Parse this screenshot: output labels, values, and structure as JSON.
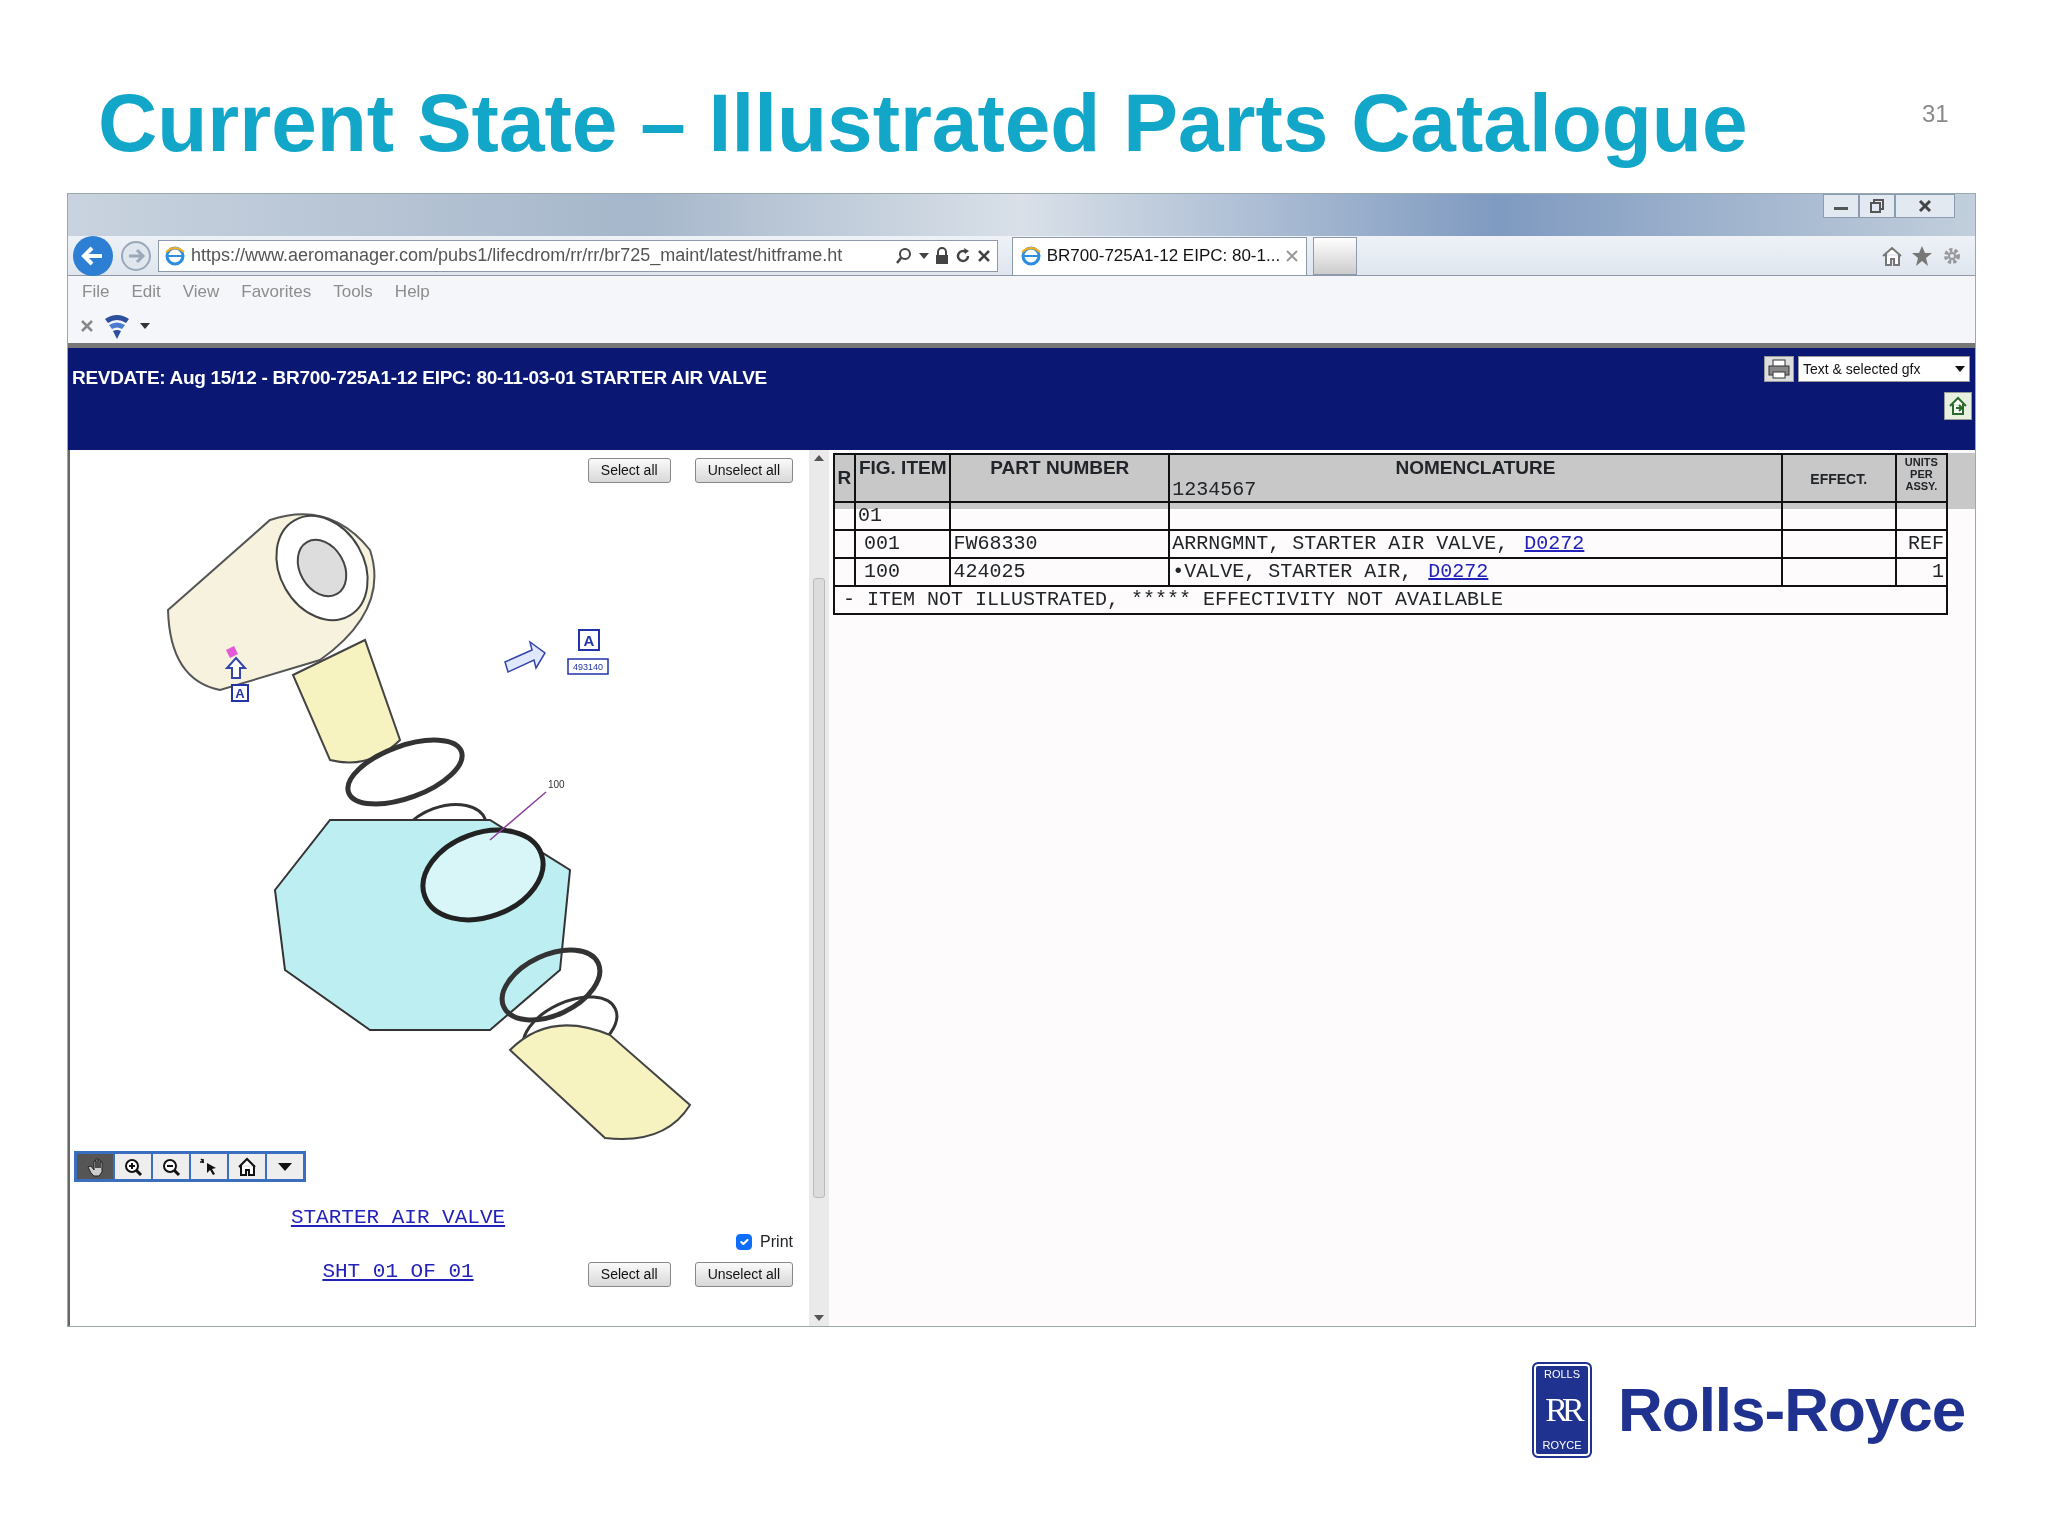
{
  "slide": {
    "title": "Current State – Illustrated Parts Catalogue",
    "page_number": "31"
  },
  "browser": {
    "address": "https://www.aeromanager.com/pubs1/lifecdrom/rr/rr/br725_maint/latest/hitframe.ht",
    "tabs": [
      {
        "label": "BR700-725A1-12 EIPC: 80-1...",
        "selected": true
      }
    ],
    "menu": [
      "File",
      "Edit",
      "View",
      "Favorites",
      "Tools",
      "Help"
    ]
  },
  "header": {
    "title": "REVDATE: Aug 15/12 - BR700-725A1-12 EIPC: 80-11-03-01 STARTER AIR VALVE",
    "view_select": "Text & selected gfx"
  },
  "figure": {
    "top_buttons": [
      "Select all",
      "Unselect all"
    ],
    "callouts": [
      "A",
      "493140",
      "A",
      "100"
    ],
    "zoom_tools": [
      {
        "kind": "pan",
        "selected": true
      },
      {
        "kind": "zoom-in",
        "selected": false
      },
      {
        "kind": "zoom-out",
        "selected": false
      },
      {
        "kind": "select",
        "selected": false
      },
      {
        "kind": "home",
        "selected": false
      },
      {
        "kind": "menu",
        "selected": false
      }
    ],
    "links": [
      "STARTER AIR VALVE",
      "SHT 01 OF 01"
    ],
    "print": {
      "label": "Print",
      "checked": true
    },
    "bottom_buttons": [
      "Select all",
      "Unselect all"
    ]
  },
  "table": {
    "columns": [
      "R",
      "FIG. ITEM",
      "PART NUMBER",
      "NOMENCLATURE",
      "EFFECT.",
      "UNITS PER ASSY."
    ],
    "nomenclature_sub": "1234567",
    "rows": [
      {
        "fig_item": "01"
      },
      {
        "fig_item": "001",
        "part_number": "FW68330",
        "nomenclature": "ARRNGMNT, STARTER AIR VALVE,",
        "link": "D0272",
        "units": "REF"
      },
      {
        "fig_item": "100",
        "part_number": "424025",
        "nomenclature": "•VALVE, STARTER AIR,",
        "link": "D0272",
        "units": "1"
      }
    ],
    "footnote": "- ITEM NOT ILLUSTRATED, ***** EFFECTIVITY NOT AVAILABLE"
  },
  "logo": {
    "badge_top": "ROLLS",
    "monogram": "RR",
    "badge_bottom": "ROYCE",
    "wordmark": "Rolls-Royce"
  }
}
